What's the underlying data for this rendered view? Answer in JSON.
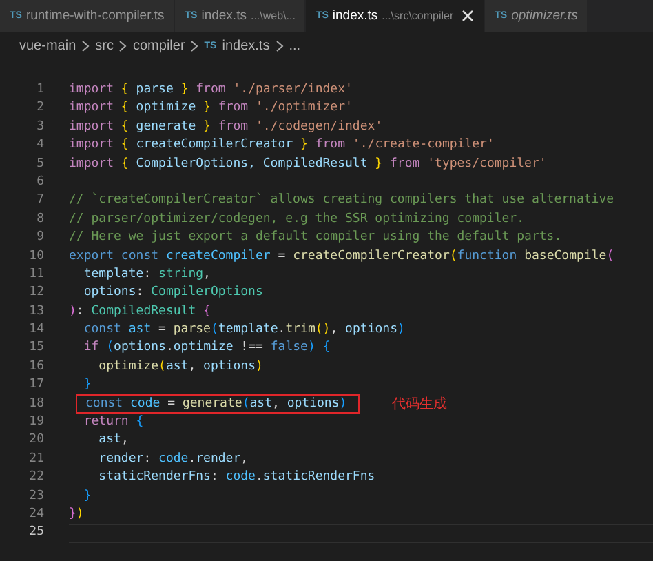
{
  "tabs": [
    {
      "icon": "TS",
      "label": "runtime-with-compiler.ts",
      "selected": false,
      "preview": false
    },
    {
      "icon": "TS",
      "label": "index.ts",
      "path": "...\\web\\...",
      "selected": false,
      "preview": false
    },
    {
      "icon": "TS",
      "label": "index.ts",
      "path": "...\\src\\compiler",
      "selected": true,
      "preview": false
    },
    {
      "icon": "TS",
      "label": "optimizer.ts",
      "selected": false,
      "preview": true
    }
  ],
  "breadcrumb": [
    {
      "label": "vue-main"
    },
    {
      "label": "src"
    },
    {
      "label": "compiler"
    },
    {
      "label": "index.ts",
      "icon": "TS"
    },
    {
      "label": "..."
    }
  ],
  "editor": {
    "lines": [
      {
        "number": "1",
        "current": false,
        "tokens": [
          {
            "kind": "kw",
            "text": "import"
          },
          {
            "kind": "b1",
            "text": " {"
          },
          {
            "kind": "var",
            "text": " parse"
          },
          {
            "kind": "b1",
            "text": " }"
          },
          {
            "kind": "kw",
            "text": " from"
          },
          {
            "kind": "str",
            "text": " './parser/index'"
          }
        ]
      },
      {
        "number": "2",
        "current": false,
        "tokens": [
          {
            "kind": "kw",
            "text": "import"
          },
          {
            "kind": "b1",
            "text": " {"
          },
          {
            "kind": "var",
            "text": " optimize"
          },
          {
            "kind": "b1",
            "text": " }"
          },
          {
            "kind": "kw",
            "text": " from"
          },
          {
            "kind": "str",
            "text": " './optimizer'"
          }
        ]
      },
      {
        "number": "3",
        "current": false,
        "tokens": [
          {
            "kind": "kw",
            "text": "import"
          },
          {
            "kind": "b1",
            "text": " {"
          },
          {
            "kind": "var",
            "text": " generate"
          },
          {
            "kind": "b1",
            "text": " }"
          },
          {
            "kind": "kw",
            "text": " from"
          },
          {
            "kind": "str",
            "text": " './codegen/index'"
          }
        ]
      },
      {
        "number": "4",
        "current": false,
        "tokens": [
          {
            "kind": "kw",
            "text": "import"
          },
          {
            "kind": "b1",
            "text": " {"
          },
          {
            "kind": "var",
            "text": " createCompilerCreator"
          },
          {
            "kind": "b1",
            "text": " }"
          },
          {
            "kind": "kw",
            "text": " from"
          },
          {
            "kind": "str",
            "text": " './create-compiler'"
          }
        ]
      },
      {
        "number": "5",
        "current": false,
        "tokens": [
          {
            "kind": "kw",
            "text": "import"
          },
          {
            "kind": "b1",
            "text": " {"
          },
          {
            "kind": "var",
            "text": " CompilerOptions, CompiledResult"
          },
          {
            "kind": "b1",
            "text": " }"
          },
          {
            "kind": "kw",
            "text": " from"
          },
          {
            "kind": "str",
            "text": " 'types/compiler'"
          }
        ]
      },
      {
        "number": "6",
        "current": false
      },
      {
        "number": "7",
        "current": false,
        "tokens": [
          {
            "kind": "cm",
            "text": "// `createCompilerCreator` allows creating compilers that use alternative"
          }
        ]
      },
      {
        "number": "8",
        "current": false,
        "tokens": [
          {
            "kind": "cm",
            "text": "// parser/optimizer/codegen, e.g the SSR optimizing compiler."
          }
        ]
      },
      {
        "number": "9",
        "current": false,
        "tokens": [
          {
            "kind": "cm",
            "text": "// Here we just export a default compiler using the default parts."
          }
        ]
      },
      {
        "number": "10",
        "current": false,
        "tokens": [
          {
            "kind": "kw2",
            "text": "export"
          },
          {
            "kind": "kw2",
            "text": " const"
          },
          {
            "kind": "con",
            "text": " createCompiler"
          },
          {
            "kind": "p",
            "text": " ="
          },
          {
            "kind": "fn",
            "text": " createCompilerCreator"
          },
          {
            "kind": "b1",
            "text": "("
          },
          {
            "kind": "kw2",
            "text": "function"
          },
          {
            "kind": "fn",
            "text": " baseCompile"
          },
          {
            "kind": "b2",
            "text": "("
          }
        ]
      },
      {
        "number": "11",
        "current": false,
        "tokens": [
          {
            "kind": "var",
            "text": "  template"
          },
          {
            "kind": "p",
            "text": ":"
          },
          {
            "kind": "type",
            "text": " string"
          },
          {
            "kind": "p",
            "text": ","
          }
        ]
      },
      {
        "number": "12",
        "current": false,
        "tokens": [
          {
            "kind": "var",
            "text": "  options"
          },
          {
            "kind": "p",
            "text": ":"
          },
          {
            "kind": "type",
            "text": " CompilerOptions"
          }
        ]
      },
      {
        "number": "13",
        "current": false,
        "tokens": [
          {
            "kind": "b2",
            "text": ")"
          },
          {
            "kind": "p",
            "text": ":"
          },
          {
            "kind": "type",
            "text": " CompiledResult"
          },
          {
            "kind": "b2",
            "text": " {"
          }
        ]
      },
      {
        "number": "14",
        "current": false,
        "tokens": [
          {
            "kind": "kw2",
            "text": "  const"
          },
          {
            "kind": "con",
            "text": " ast"
          },
          {
            "kind": "p",
            "text": " ="
          },
          {
            "kind": "fn",
            "text": " parse"
          },
          {
            "kind": "b3",
            "text": "("
          },
          {
            "kind": "var",
            "text": "template"
          },
          {
            "kind": "p",
            "text": "."
          },
          {
            "kind": "fn",
            "text": "trim"
          },
          {
            "kind": "b1",
            "text": "()"
          },
          {
            "kind": "p",
            "text": ","
          },
          {
            "kind": "var",
            "text": " options"
          },
          {
            "kind": "b3",
            "text": ")"
          }
        ]
      },
      {
        "number": "15",
        "current": false,
        "tokens": [
          {
            "kind": "kw",
            "text": "  if"
          },
          {
            "kind": "b3",
            "text": " ("
          },
          {
            "kind": "var",
            "text": "options"
          },
          {
            "kind": "p",
            "text": "."
          },
          {
            "kind": "var",
            "text": "optimize"
          },
          {
            "kind": "p",
            "text": " !=="
          },
          {
            "kind": "kw2",
            "text": " false"
          },
          {
            "kind": "b3",
            "text": ")"
          },
          {
            "kind": "b3",
            "text": " {"
          }
        ]
      },
      {
        "number": "16",
        "current": false,
        "tokens": [
          {
            "kind": "fn",
            "text": "    optimize"
          },
          {
            "kind": "b1",
            "text": "("
          },
          {
            "kind": "var",
            "text": "ast"
          },
          {
            "kind": "p",
            "text": ","
          },
          {
            "kind": "var",
            "text": " options"
          },
          {
            "kind": "b1",
            "text": ")"
          }
        ]
      },
      {
        "number": "17",
        "current": false,
        "tokens": [
          {
            "kind": "b3",
            "text": "  }"
          }
        ]
      },
      {
        "number": "18",
        "current": false,
        "annotation": "代码生成",
        "tokens": [
          {
            "kind": "kw2",
            "text": "const"
          },
          {
            "kind": "con",
            "text": " code"
          },
          {
            "kind": "p",
            "text": " ="
          },
          {
            "kind": "fn",
            "text": " generate"
          },
          {
            "kind": "b3",
            "text": "("
          },
          {
            "kind": "var",
            "text": "ast"
          },
          {
            "kind": "p",
            "text": ","
          },
          {
            "kind": "var",
            "text": " options"
          },
          {
            "kind": "b3",
            "text": ")"
          }
        ]
      },
      {
        "number": "19",
        "current": false,
        "tokens": [
          {
            "kind": "kw",
            "text": "  return"
          },
          {
            "kind": "b3",
            "text": " {"
          }
        ]
      },
      {
        "number": "20",
        "current": false,
        "tokens": [
          {
            "kind": "var",
            "text": "    ast"
          },
          {
            "kind": "p",
            "text": ","
          }
        ]
      },
      {
        "number": "21",
        "current": false,
        "tokens": [
          {
            "kind": "var",
            "text": "    render"
          },
          {
            "kind": "p",
            "text": ":"
          },
          {
            "kind": "con",
            "text": " code"
          },
          {
            "kind": "p",
            "text": "."
          },
          {
            "kind": "var",
            "text": "render"
          },
          {
            "kind": "p",
            "text": ","
          }
        ]
      },
      {
        "number": "22",
        "current": false,
        "tokens": [
          {
            "kind": "var",
            "text": "    staticRenderFns"
          },
          {
            "kind": "p",
            "text": ":"
          },
          {
            "kind": "con",
            "text": " code"
          },
          {
            "kind": "p",
            "text": "."
          },
          {
            "kind": "var",
            "text": "staticRenderFns"
          }
        ]
      },
      {
        "number": "23",
        "current": false,
        "tokens": [
          {
            "kind": "b3",
            "text": "  }"
          }
        ]
      },
      {
        "number": "24",
        "current": false,
        "tokens": [
          {
            "kind": "b2",
            "text": "}"
          },
          {
            "kind": "b1",
            "text": ")"
          }
        ]
      },
      {
        "number": "25",
        "current": true
      }
    ]
  }
}
